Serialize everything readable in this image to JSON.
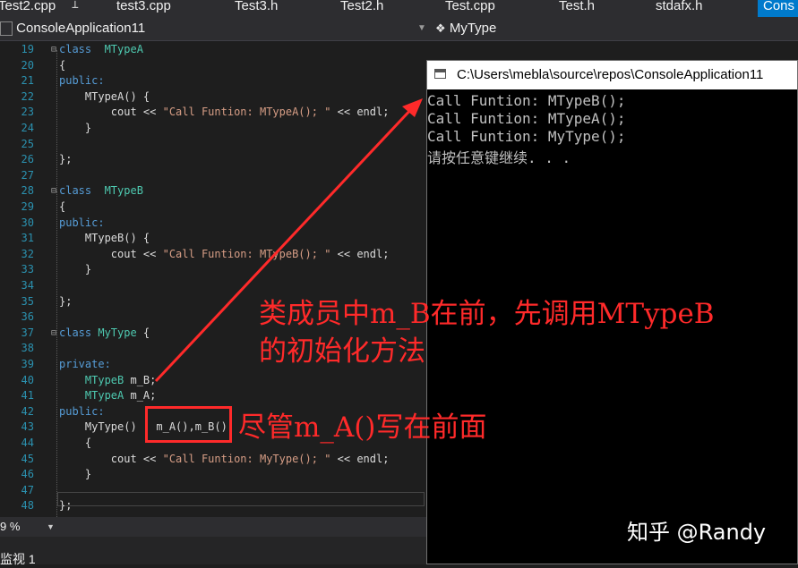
{
  "tabs": [
    "Test2.cpp",
    "test3.cpp",
    "Test3.h",
    "Test2.h",
    "Test.cpp",
    "Test.h",
    "stdafx.h",
    "Cons"
  ],
  "nav": {
    "project": "ConsoleApplication11",
    "scope": "MyType",
    "dropdown_icon": "chevron-down-icon",
    "scope_icon": "class-icon"
  },
  "code_lines": [
    {
      "n": "19",
      "segs": [
        [
          "kw",
          "class"
        ],
        [
          "",
          ""
        ],
        [
          "ty",
          "  MTypeA"
        ]
      ]
    },
    {
      "n": "20",
      "segs": [
        [
          "",
          "{"
        ]
      ]
    },
    {
      "n": "21",
      "segs": [
        [
          "kw",
          "public:"
        ]
      ]
    },
    {
      "n": "22",
      "segs": [
        [
          "",
          "    MTypeA() {"
        ]
      ]
    },
    {
      "n": "23",
      "segs": [
        [
          "",
          "        cout << "
        ],
        [
          "st",
          "\"Call Funtion: MTypeA(); \""
        ],
        [
          "",
          " << endl;"
        ]
      ]
    },
    {
      "n": "24",
      "segs": [
        [
          "",
          "    }"
        ]
      ]
    },
    {
      "n": "25",
      "segs": [
        [
          "",
          ""
        ]
      ]
    },
    {
      "n": "26",
      "segs": [
        [
          "",
          "};"
        ]
      ]
    },
    {
      "n": "27",
      "segs": [
        [
          "",
          ""
        ]
      ]
    },
    {
      "n": "28",
      "segs": [
        [
          "kw",
          "class"
        ],
        [
          "ty",
          "  MTypeB"
        ]
      ]
    },
    {
      "n": "29",
      "segs": [
        [
          "",
          "{"
        ]
      ]
    },
    {
      "n": "30",
      "segs": [
        [
          "kw",
          "public:"
        ]
      ]
    },
    {
      "n": "31",
      "segs": [
        [
          "",
          "    MTypeB() {"
        ]
      ]
    },
    {
      "n": "32",
      "segs": [
        [
          "",
          "        cout << "
        ],
        [
          "st",
          "\"Call Funtion: MTypeB(); \""
        ],
        [
          "",
          " << endl;"
        ]
      ]
    },
    {
      "n": "33",
      "segs": [
        [
          "",
          "    }"
        ]
      ]
    },
    {
      "n": "34",
      "segs": [
        [
          "",
          ""
        ]
      ]
    },
    {
      "n": "35",
      "segs": [
        [
          "",
          "};"
        ]
      ]
    },
    {
      "n": "36",
      "segs": [
        [
          "",
          ""
        ]
      ]
    },
    {
      "n": "37",
      "segs": [
        [
          "kw",
          "class"
        ],
        [
          "ty",
          " MyType"
        ],
        [
          "",
          " {"
        ]
      ]
    },
    {
      "n": "38",
      "segs": [
        [
          "",
          ""
        ]
      ]
    },
    {
      "n": "39",
      "segs": [
        [
          "kw",
          "private:"
        ]
      ]
    },
    {
      "n": "40",
      "segs": [
        [
          "ty",
          "    MTypeB"
        ],
        [
          "",
          " m_B;"
        ]
      ]
    },
    {
      "n": "41",
      "segs": [
        [
          "ty",
          "    MTypeA"
        ],
        [
          "",
          " m_A;"
        ]
      ]
    },
    {
      "n": "42",
      "segs": [
        [
          "kw",
          "public:"
        ]
      ]
    },
    {
      "n": "43",
      "segs": [
        [
          "",
          "    MyType() : m_A(),m_B()"
        ]
      ]
    },
    {
      "n": "44",
      "segs": [
        [
          "",
          "    {"
        ]
      ]
    },
    {
      "n": "45",
      "segs": [
        [
          "",
          "        cout << "
        ],
        [
          "st",
          "\"Call Funtion: MyType(); \""
        ],
        [
          "",
          " << endl;"
        ]
      ]
    },
    {
      "n": "46",
      "segs": [
        [
          "",
          "    }"
        ]
      ]
    },
    {
      "n": "47",
      "segs": [
        [
          "",
          ""
        ]
      ]
    },
    {
      "n": "48",
      "segs": [
        [
          "",
          "};"
        ]
      ]
    }
  ],
  "status": {
    "zoom": "9 %",
    "bottom_label": "监视 1"
  },
  "console": {
    "title": "C:\\Users\\mebla\\source\\repos\\ConsoleApplication11",
    "lines": [
      "Call Funtion: MTypeB();",
      "Call Funtion: MTypeA();",
      "Call Funtion: MyType();",
      "请按任意键继续. . ."
    ]
  },
  "annotations": {
    "line1": "类成员中m_B在前，先调用MTypeB",
    "line2": "的初始化方法",
    "note": "尽管m_A()写在前面"
  },
  "watermark": "知乎 @Randy",
  "colors": {
    "annotation": "#ff2a2a",
    "keyword": "#569cd6",
    "type": "#4ec9b0",
    "string": "#d69d85",
    "line_number": "#2b91af",
    "active_tab": "#007acc"
  }
}
